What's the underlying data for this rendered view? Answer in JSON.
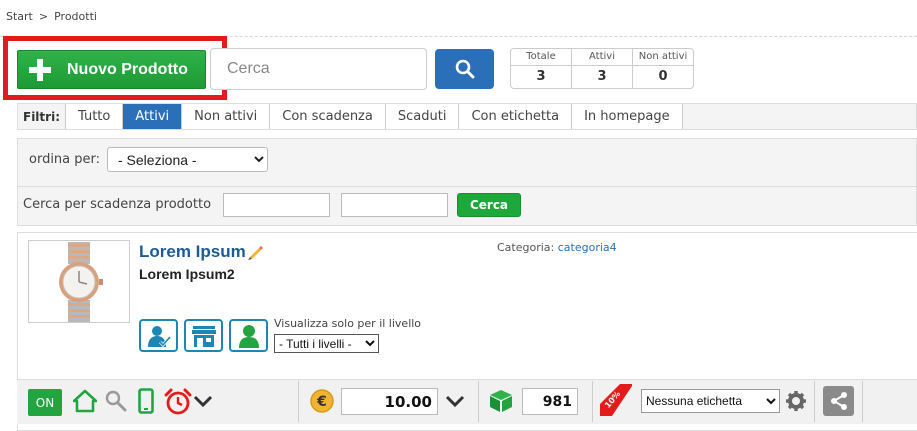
{
  "breadcrumb": {
    "home": "Start",
    "separator": ">",
    "current": "Prodotti"
  },
  "toolbar_top": {
    "new_product_label": "Nuovo Prodotto",
    "search_placeholder": "Cerca",
    "search_icon": "magnifier-icon"
  },
  "counters": [
    {
      "label": "Totale",
      "value": "3"
    },
    {
      "label": "Attivi",
      "value": "3"
    },
    {
      "label": "Non attivi",
      "value": "0"
    }
  ],
  "filters": {
    "label": "Filtri:",
    "tabs": [
      "Tutto",
      "Attivi",
      "Non attivi",
      "Con scadenza",
      "Scaduti",
      "Con etichetta",
      "In homepage"
    ],
    "active": "Attivi"
  },
  "sort": {
    "label": "ordina per:",
    "selected": "- Seleziona -"
  },
  "expiry_search": {
    "label": "Cerca per scadenza prodotto",
    "button": "Cerca"
  },
  "product": {
    "title": "Lorem Ipsum",
    "subtitle": "Lorem Ipsum2",
    "category_label": "Categoria:",
    "category_value": "categoria4",
    "level_label": "Visualizza solo per il livello",
    "level_selected": "- Tutti i livelli -",
    "status_button": "ON",
    "price": "10.00",
    "quantity": "981",
    "discount_badge": "10%",
    "label_selected": "Nessuna etichetta"
  },
  "colors": {
    "primary_blue": "#2a6fb8",
    "green": "#1ea83b",
    "highlight_red": "#e21b1b",
    "icon_teal": "#1e86b5"
  }
}
